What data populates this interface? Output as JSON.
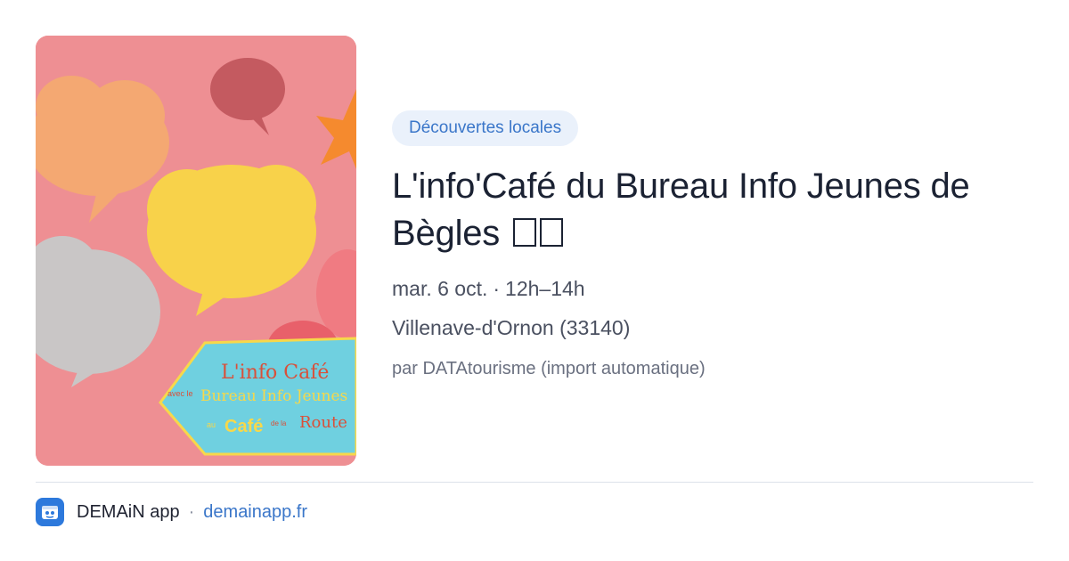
{
  "event": {
    "category": "Découvertes locales",
    "title": "L'info'Café du Bureau Info Jeunes de Bègles",
    "date": "mar. 6 oct.",
    "time": "12h–14h",
    "location": "Villenave-d'Ornon (33140)",
    "source": "par DATAtourisme (import automatique)"
  },
  "image": {
    "line1": "L'info Café",
    "line2_small": "avec le",
    "line2": "Bureau Info Jeunes",
    "line3_small": "au",
    "line3": "Café",
    "line3_small2": "de la",
    "line3_end": "Route"
  },
  "footer": {
    "app_name": "DEMAiN app",
    "separator": "·",
    "domain": "demainapp.fr"
  },
  "colors": {
    "accent": "#3a76c9",
    "tag_bg": "#eaf1fb",
    "image_bg": "#ec8f92"
  }
}
